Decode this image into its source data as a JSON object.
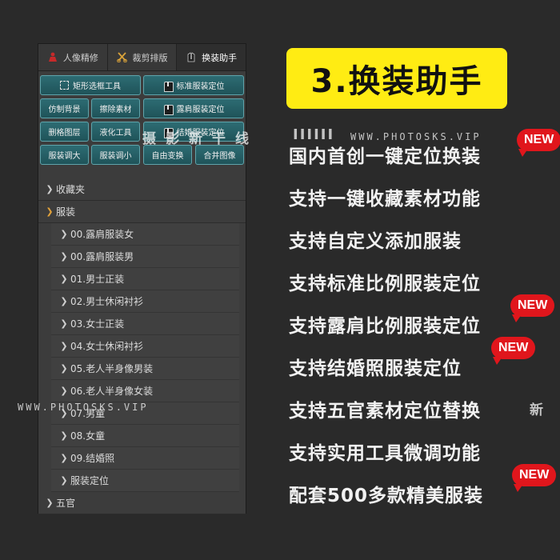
{
  "panel": {
    "tabs": [
      {
        "label": "人像精修",
        "icon": "person-icon",
        "active": false
      },
      {
        "label": "裁剪排版",
        "icon": "scissors-icon",
        "active": false
      },
      {
        "label": "换装助手",
        "icon": "suit-icon",
        "active": true
      }
    ],
    "buttons": {
      "rect_select": "矩形选框工具",
      "std_position": "标准服装定位",
      "fake_bg": "仿制背景",
      "erase": "擦除素材",
      "shoulder_position": "露肩服装定位",
      "delete_layer": "删格图层",
      "liquify": "液化工具",
      "wedding_position": "结婚服装定位",
      "enlarge": "服装调大",
      "shrink": "服装调小",
      "free_transform": "自由变换",
      "merge": "合并图像"
    },
    "tree": {
      "favorites": "收藏夹",
      "clothing": "服装",
      "items": [
        "00.露肩服装女",
        "00.露肩服装男",
        "01.男士正装",
        "02.男士休闲衬衫",
        "03.女士正装",
        "04.女士休闲衬衫",
        "05.老人半身像男装",
        "06.老人半身像女装",
        "07.男童",
        "08.女童",
        "09.结婚照",
        "服装定位"
      ],
      "features": "五官"
    }
  },
  "title": "3.换装助手",
  "features": [
    {
      "text": "国内首创一键定位换装",
      "new": true
    },
    {
      "text": "支持一键收藏素材功能",
      "new": false
    },
    {
      "text": "支持自定义添加服装",
      "new": false
    },
    {
      "text": "支持标准比例服装定位",
      "new": false
    },
    {
      "text": "支持露肩比例服装定位",
      "new": true
    },
    {
      "text": "支持结婚照服装定位",
      "new": true
    },
    {
      "text": "支持五官素材定位替换",
      "new": false
    },
    {
      "text": "支持实用工具微调功能",
      "new": false
    },
    {
      "text": "配套500多款精美服装",
      "new": true
    }
  ],
  "new_label": "NEW",
  "watermarks": {
    "url": "WWW.PHOTOSKS.VIP",
    "cn": "摄影新干线",
    "cn_short": "新",
    "bars": "IIIIII"
  },
  "colors": {
    "accent_yellow": "#ffec13",
    "badge_red": "#e0161c",
    "button_teal": "#2d6c73"
  }
}
